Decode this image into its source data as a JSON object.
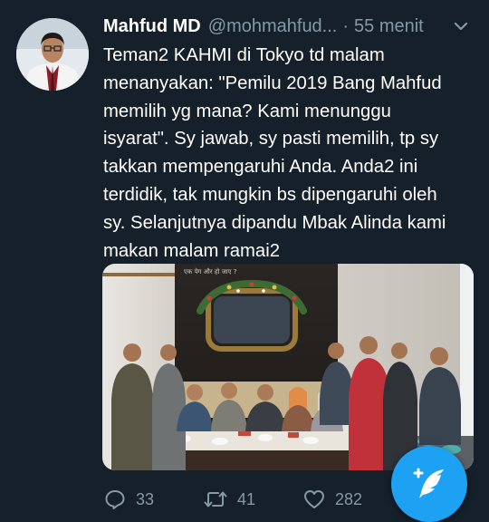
{
  "tweet": {
    "author_name": "Mahfud MD",
    "handle": "@mohmahfud...",
    "separator": "·",
    "time": "55 menit",
    "text": "Teman2 KAHMI di Tokyo td malam\nmenanyakan: \"Pemilu 2019 Bang Mahfud\nmemilih yg mana? Kami menunggu\nisyarat\". Sy jawab, sy pasti memilih, tp sy\ntakkan mempengaruhi Anda. Anda2 ini\nterdidik, tak mungkin bs dipengaruhi oleh\nsy. Selanjutnya dipandu Mbak Alinda kami\nmakan malam ramai2",
    "media": {
      "wall_text": "एक पेग और हो जाए ?"
    }
  },
  "actions": {
    "reply_count": "33",
    "retweet_count": "41",
    "like_count": "282"
  },
  "icons": {
    "options": "chevron-down-icon",
    "reply": "reply-icon",
    "retweet": "retweet-icon",
    "like": "heart-icon",
    "compose": "compose-feather-icon"
  },
  "colors": {
    "background": "#15202b",
    "secondary_text": "#8899a6",
    "accent": "#1da1f2"
  }
}
